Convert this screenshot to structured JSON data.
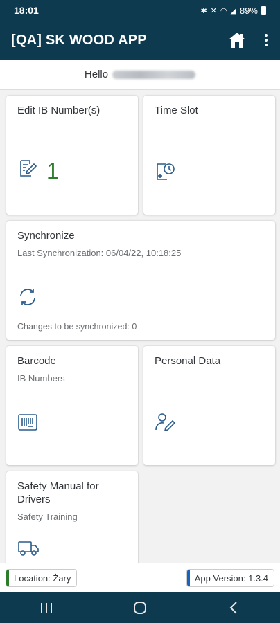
{
  "status": {
    "time": "18:01",
    "battery": "89%"
  },
  "app": {
    "title": "[QA] SK WOOD APP"
  },
  "greeting": {
    "hello": "Hello"
  },
  "tiles": {
    "edit_ib": {
      "title": "Edit IB Number(s)",
      "count": "1"
    },
    "time_slot": {
      "title": "Time Slot"
    },
    "synchronize": {
      "title": "Synchronize",
      "subtitle": "Last Synchronization: 06/04/22, 10:18:25",
      "footer": "Changes to be synchronized: 0"
    },
    "barcode": {
      "title": "Barcode",
      "subtitle": "IB Numbers"
    },
    "personal_data": {
      "title": "Personal Data"
    },
    "safety_manual": {
      "title": "Safety Manual for Drivers",
      "subtitle": "Safety Training"
    }
  },
  "footer": {
    "location": "Location: Żary",
    "app_version": "App Version: 1.3.4"
  },
  "colors": {
    "header": "#0e3a4f",
    "icon": "#2a5b8a",
    "count": "#2b7c2b",
    "location_bar": "#2b7c2b",
    "version_bar": "#1565c0"
  },
  "icons": [
    "home-icon",
    "more-vert-icon",
    "edit-document-icon",
    "time-slot-icon",
    "sync-icon",
    "barcode-icon",
    "person-edit-icon",
    "truck-icon"
  ]
}
